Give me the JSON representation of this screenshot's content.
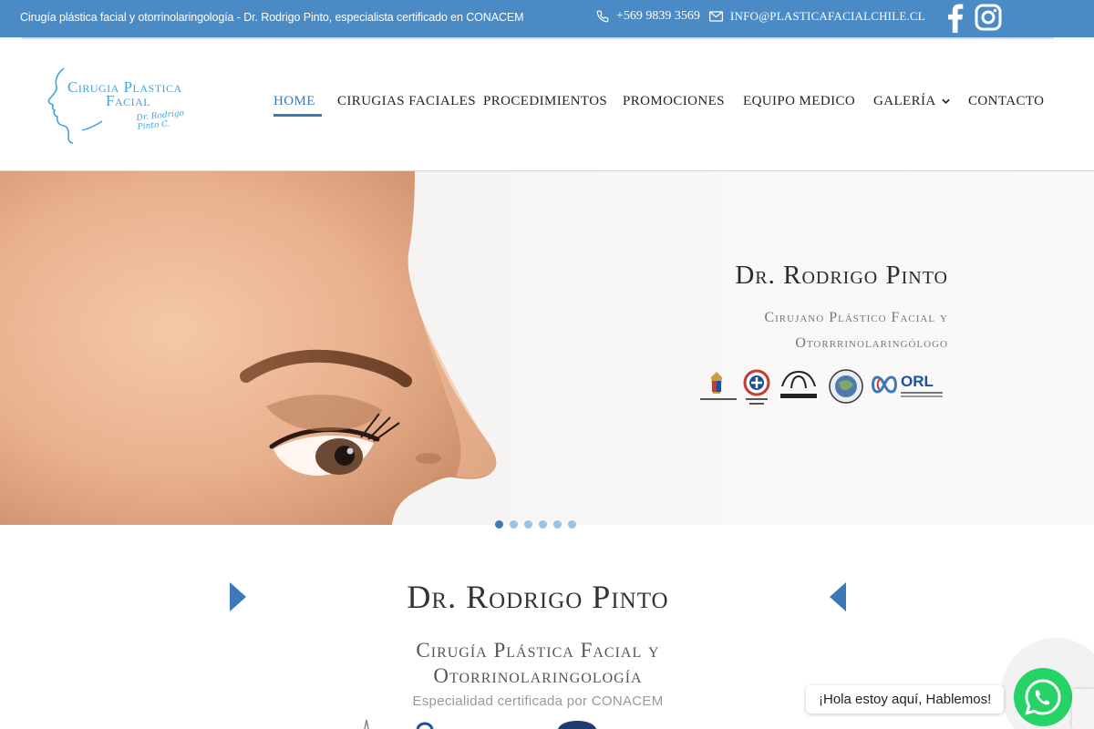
{
  "topbar": {
    "tagline": "Cirugía plástica facial y otorrinolaringología - Dr. Rodrigo Pinto, especialista certificado en CONACEM",
    "phone": "+569 9839 3569",
    "email": "INFO@PLASTICAFACIALCHILE.CL",
    "social_icons": [
      "facebook-icon",
      "instagram-icon"
    ]
  },
  "logo": {
    "line1": "Cirugia Plastica",
    "line2": "Facial",
    "signature": "Dr. Rodrigo Pinto C."
  },
  "nav": {
    "items": [
      {
        "label": "HOME",
        "active": true
      },
      {
        "label": "CIRUGIAS FACIALES"
      },
      {
        "label": "PROCEDIMIENTOS"
      },
      {
        "label": "PROMOCIONES"
      },
      {
        "label": "EQUIPO MEDICO"
      },
      {
        "label": "GALERÍA",
        "has_dropdown": true
      },
      {
        "label": "CONTACTO"
      }
    ]
  },
  "hero": {
    "title": "Dr. Rodrigo Pinto",
    "subtitle_line1": "Cirujano Plástico Facial y",
    "subtitle_line2": "Otorrrinolaringólogo",
    "logos": [
      {
        "name": "Universidad de Chile"
      },
      {
        "name": "Colegio Médico de Chile"
      },
      {
        "name": "CONACEM"
      },
      {
        "name": "seal"
      },
      {
        "name": "ORL",
        "caption": "Sociedad Chilena de Otorrinolaringología"
      }
    ],
    "slider_dots": 6,
    "active_dot": 1
  },
  "section": {
    "title": "Dr. Rodrigo Pinto",
    "subtitle_line1": "Cirugía Plástica Facial y",
    "subtitle_line2": "Otorrinolaringología",
    "certification": "Especialidad certificada por CONACEM"
  },
  "whatsapp": {
    "bubble_text": "¡Hola estoy aquí, Hablemos!"
  },
  "colors": {
    "topbar": "#4a8bc6",
    "accent": "#3d79b8",
    "logo": "#3ea6d8",
    "whatsapp": "#25d366"
  }
}
